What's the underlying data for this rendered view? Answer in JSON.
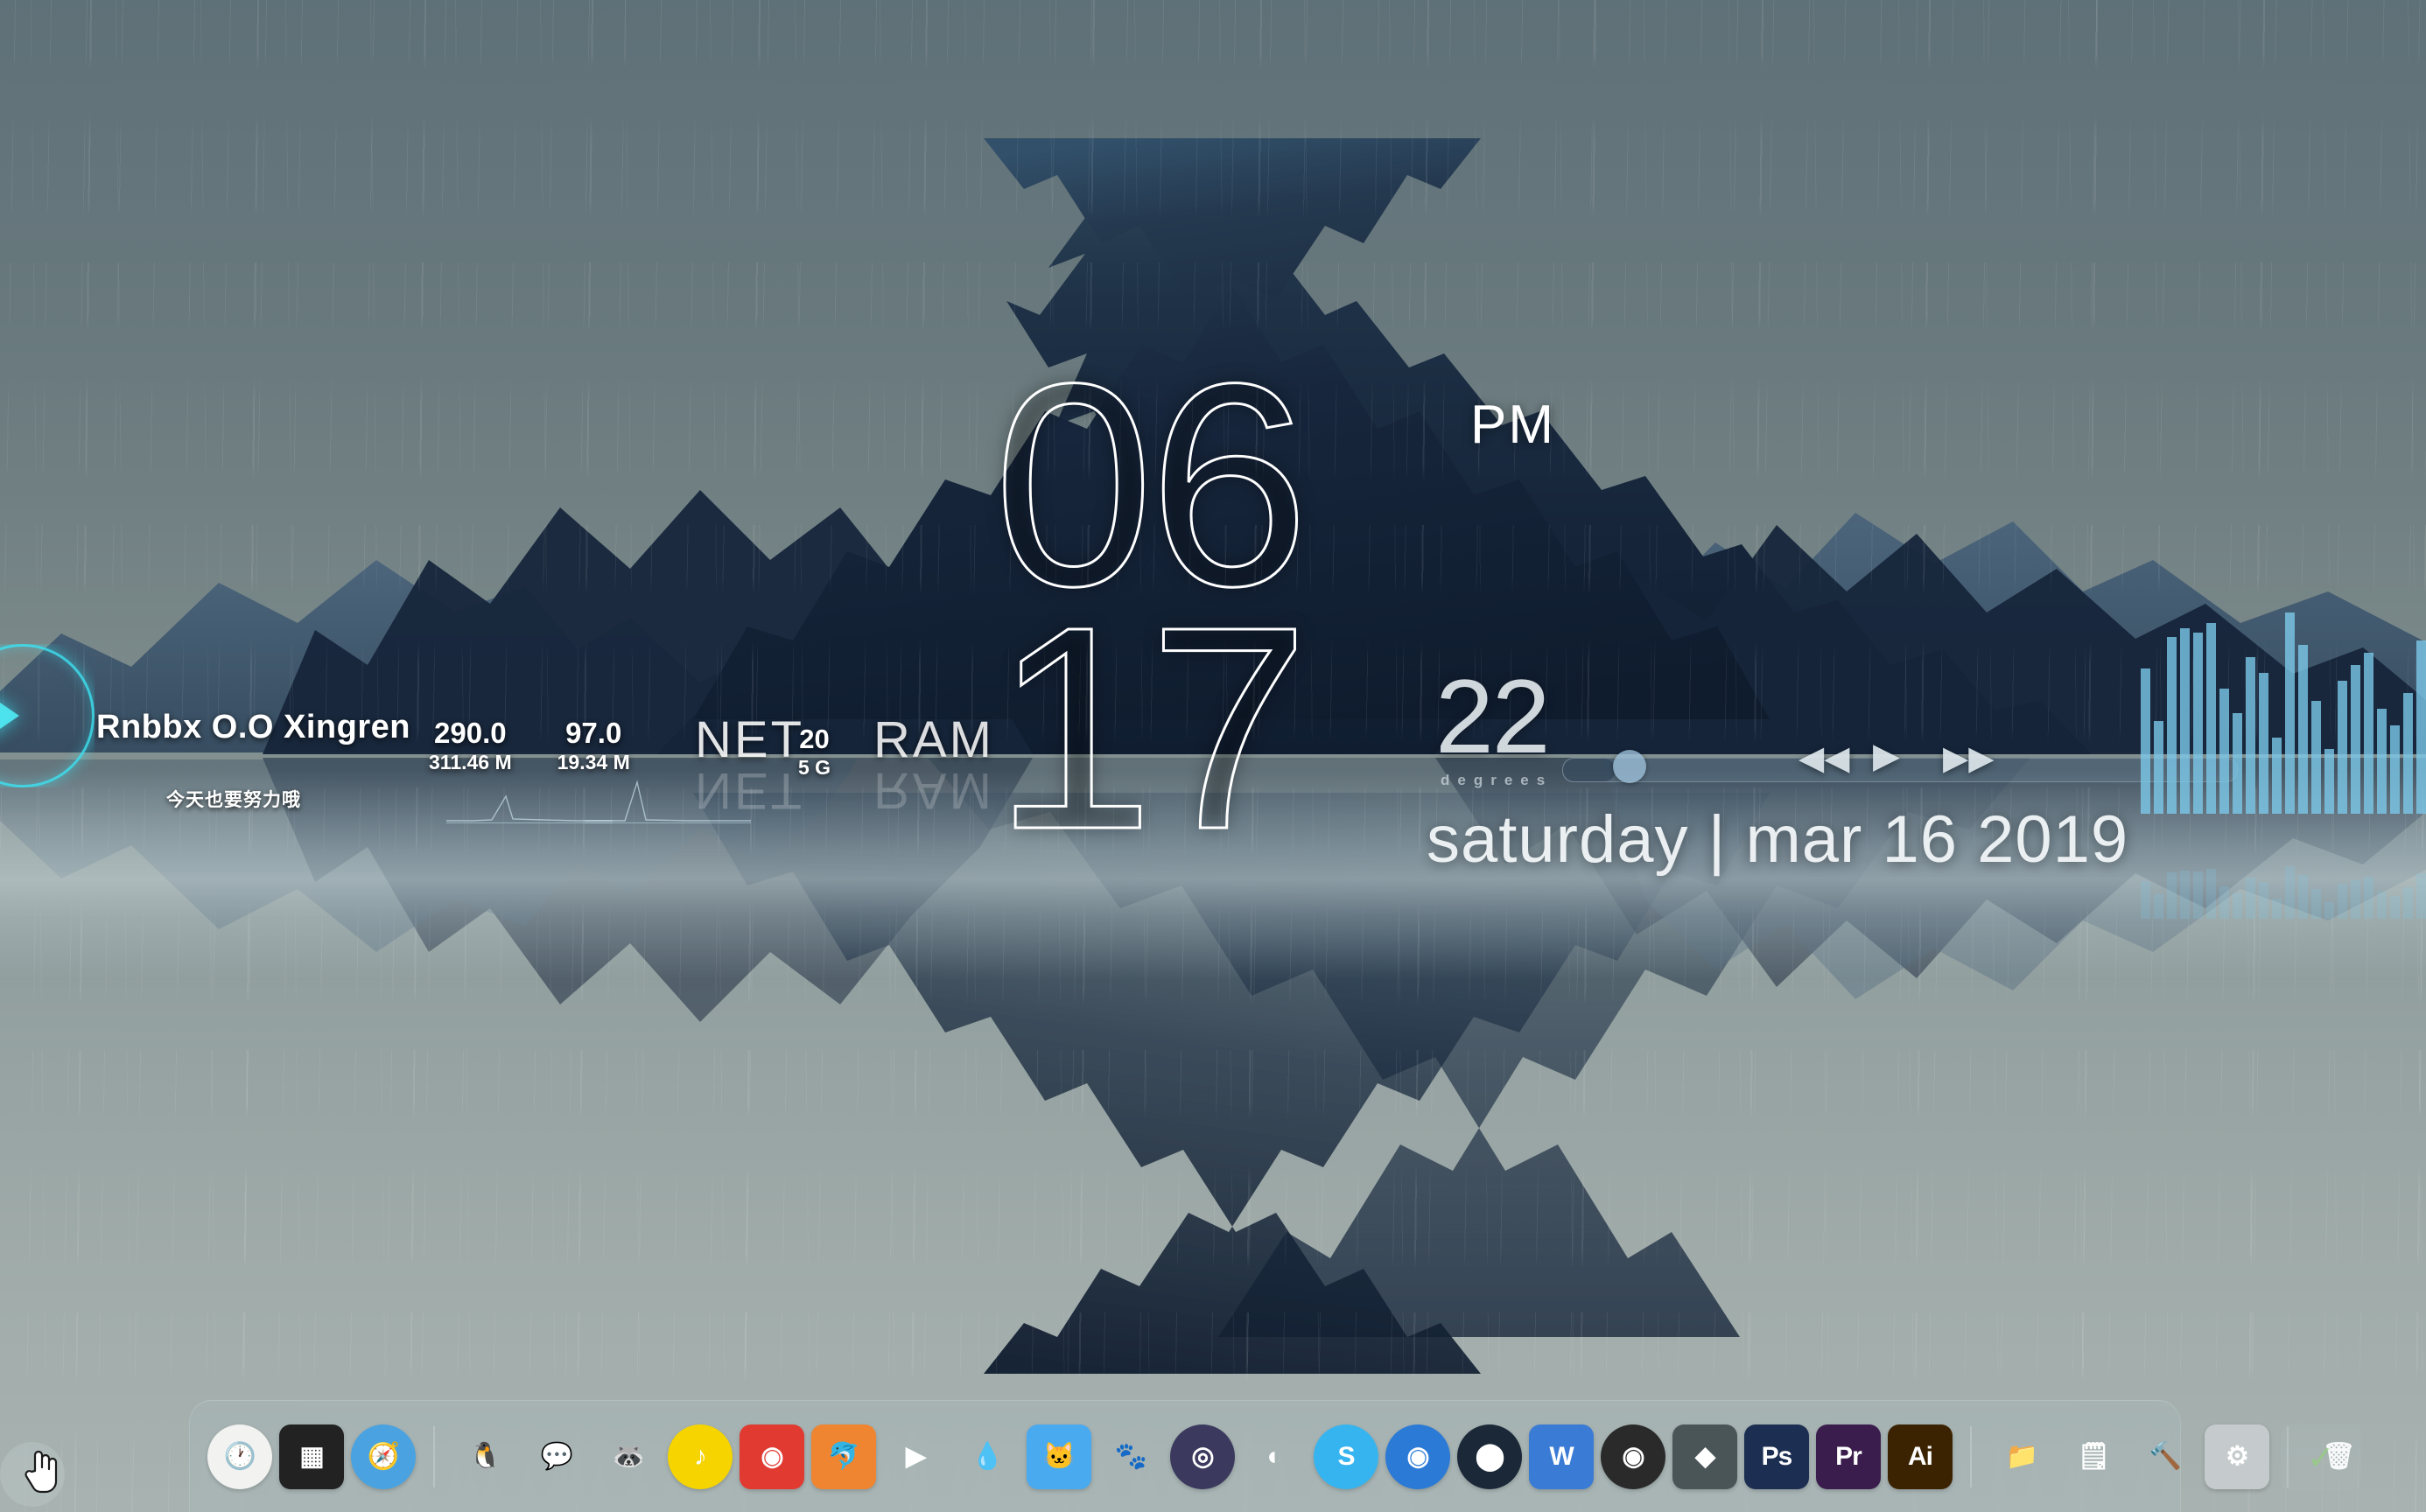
{
  "wallpaper": {
    "scene": "rainy-mountain-lake-reflection",
    "sky_color": "#65767c",
    "water_color": "#97a3a2",
    "mountain_color": "#1a2838",
    "rain": true
  },
  "corner_widget": {
    "name": "play-orb",
    "accent_color": "#3ce1f0"
  },
  "system_info": {
    "username": "Rnbbx O.O Xingren",
    "motto": "今天也要努力哦",
    "net": {
      "label": "NET",
      "down_speed": "290.0",
      "down_total": "311.46 M",
      "up_speed": "97.0",
      "up_total": "19.34 M"
    },
    "ram": {
      "label": "RAM",
      "used": "20",
      "total": "5 G"
    }
  },
  "clock": {
    "hours": "06",
    "minutes": "17",
    "meridiem": "PM",
    "temperature": "22",
    "temperature_unit": "degrees",
    "date": "saturday | mar 16 2019"
  },
  "media_player": {
    "prev_label": "◀◀",
    "play_label": "▶",
    "next_label": "▶▶",
    "progress_percent": 8
  },
  "visualizer": {
    "bar_color": "#7cc8e8",
    "bars": [
      72,
      46,
      88,
      92,
      90,
      95,
      62,
      50,
      78,
      70,
      38,
      100,
      84,
      56,
      32,
      66,
      74,
      80,
      52,
      44,
      60,
      86
    ]
  },
  "dock": {
    "items": [
      {
        "name": "clock-app",
        "label": "🕐",
        "bg": "#f2f2f0",
        "round": true
      },
      {
        "name": "mission-control-app",
        "label": "▦",
        "bg": "#222222"
      },
      {
        "name": "safari-app",
        "label": "🧭",
        "bg": "#4aa3e0",
        "round": true
      },
      {
        "name": "separator-1",
        "label": "",
        "bg": "",
        "sep": true
      },
      {
        "name": "qq-app",
        "label": "🐧",
        "bg": "transparent"
      },
      {
        "name": "wechat-app",
        "label": "💬",
        "bg": "transparent"
      },
      {
        "name": "raccoon-app",
        "label": "🦝",
        "bg": "transparent"
      },
      {
        "name": "qq-music-app",
        "label": "♪",
        "bg": "#f5d400",
        "round": true
      },
      {
        "name": "netease-music-app",
        "label": "◉",
        "bg": "#e03a31"
      },
      {
        "name": "xunlei-app",
        "label": "🐬",
        "bg": "#ef8530"
      },
      {
        "name": "potplayer-app",
        "label": "▶",
        "bg": "transparent"
      },
      {
        "name": "waterdrop-app",
        "label": "💧",
        "bg": "transparent"
      },
      {
        "name": "bilibili-app",
        "label": "🐱",
        "bg": "#4aaaf0"
      },
      {
        "name": "baidu-app",
        "label": "🐾",
        "bg": "transparent"
      },
      {
        "name": "circle-app",
        "label": "◎",
        "bg": "#3b3a5e",
        "round": true
      },
      {
        "name": "origin-app",
        "label": "◐",
        "bg": "transparent"
      },
      {
        "name": "sogou-app",
        "label": "S",
        "bg": "#36b4ef",
        "round": true
      },
      {
        "name": "spiral-app",
        "label": "◉",
        "bg": "#2b7ad6",
        "round": true
      },
      {
        "name": "steam-app",
        "label": "⬤",
        "bg": "#1b2838",
        "round": true
      },
      {
        "name": "wps-app",
        "label": "W",
        "bg": "#3a7bd5"
      },
      {
        "name": "obs-app",
        "label": "◉",
        "bg": "#2a2a2a",
        "round": true
      },
      {
        "name": "sublime-text-app",
        "label": "◆",
        "bg": "#4a5558"
      },
      {
        "name": "photoshop-app",
        "label": "Ps",
        "bg": "#1c2e52"
      },
      {
        "name": "premiere-app",
        "label": "Pr",
        "bg": "#3a1d4d"
      },
      {
        "name": "illustrator-app",
        "label": "Ai",
        "bg": "#3b2302"
      },
      {
        "name": "separator-2",
        "label": "",
        "bg": "",
        "sep": true
      },
      {
        "name": "documents-folder",
        "label": "📁",
        "bg": "transparent"
      },
      {
        "name": "notes-app",
        "label": "🗒",
        "bg": "transparent"
      },
      {
        "name": "tools-app",
        "label": "🔨",
        "bg": "transparent"
      },
      {
        "name": "settings-app",
        "label": "⚙",
        "bg": "#c5cbcc"
      },
      {
        "name": "separator-3",
        "label": "",
        "bg": "",
        "sep": true
      },
      {
        "name": "recycle-bin",
        "label": "🗑",
        "bg": "transparent"
      }
    ]
  },
  "cursor": {
    "type": "hand-pointer"
  },
  "tray": {
    "check_icon": "✓"
  }
}
